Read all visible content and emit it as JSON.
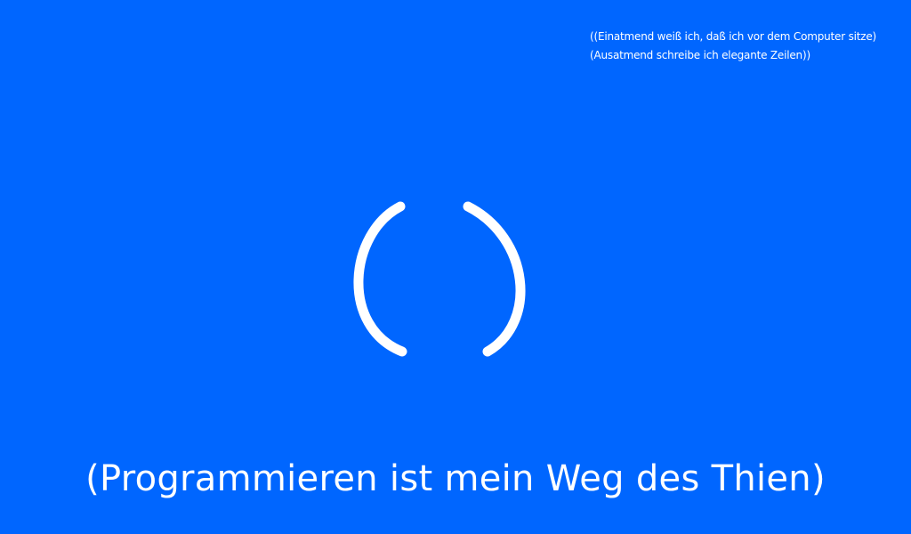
{
  "background_color": "#0066ff",
  "text_color": "#ffffff",
  "quote": {
    "line1": "((Einatmend weiß ich, daß ich vor dem Computer sitze)",
    "line2": "(Ausatmend schreibe ich elegante Zeilen))"
  },
  "center_symbol": "( )",
  "headline": "(Programmieren ist mein Weg des Thien)"
}
